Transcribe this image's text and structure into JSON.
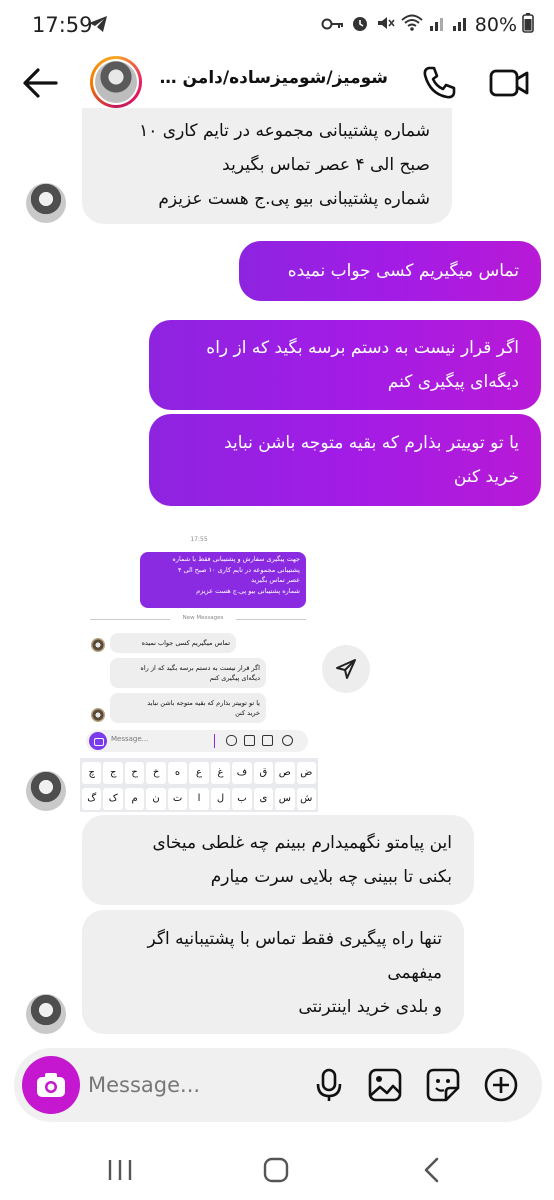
{
  "status_bar": {
    "time": "17:59",
    "battery": "80%",
    "icons": [
      "telegram-icon",
      "key-icon",
      "alarm-icon",
      "mute-icon",
      "wifi-icon",
      "signal-icon",
      "signal-icon",
      "battery-icon"
    ]
  },
  "header": {
    "title": "شومیز/شومیزساده/دامن شل...",
    "icons": [
      "back-arrow-icon",
      "phone-icon",
      "video-icon"
    ]
  },
  "messages": {
    "m1": {
      "lines": [
        "شماره پشتیبانی مجموعه در تایم کاری ۱۰",
        "صبح الی ۴ عصر تماس بگیرید",
        "شماره پشتیبانی بیو پی.ج هست عزیزم"
      ]
    },
    "m2": {
      "lines": [
        "تماس میگیریم کسی جواب نمیده"
      ]
    },
    "m3": {
      "lines": [
        "اگر قرار نیست به دستم برسه بگید که از راه",
        "دیگه‌ای پیگیری کنم"
      ]
    },
    "m4": {
      "lines": [
        "یا تو توییتر بذارم که بقیه متوجه باشن نباید",
        "خرید کنن"
      ]
    },
    "m5": {
      "lines": [
        "این پیامتو نگهمیدارم ببینم چه غلطی میخای",
        "بکنی تا ببینی چه بلایی سرت میارم"
      ]
    },
    "m6": {
      "lines": [
        "تنها راه پیگیری فقط تماس با پشتیبانیه اگر",
        "میفهمی",
        "و بلدی خرید اینترنتی"
      ]
    }
  },
  "shared_screenshot": {
    "time": "17:55",
    "outgoing": [
      "جهت پیگیری سفارش و پشتیبانی فقط با شماره",
      "پشتیبانی مجموعه در تایم کاری ۱۰ صبح الی ۴",
      "عصر تماس بگیرید",
      "شماره پشتیبانی بیو پی.ج هست عزیزم"
    ],
    "new_messages": "New Messages",
    "in1": [
      "تماس میگیریم کسی جواب نمیده"
    ],
    "in2": [
      "اگر قرار نیست به دستم برسه بگید که از راه",
      "دیگه‌ای پیگیری کنم"
    ],
    "in3": [
      "یا تو توییتر بذارم که بقیه متوجه باشن نباید",
      "خرید کنن"
    ],
    "composer_placeholder": "Message...",
    "keyboard_row1": [
      "ض",
      "ص",
      "ق",
      "ف",
      "غ",
      "ع",
      "ه",
      "خ",
      "ح",
      "ج",
      "چ"
    ],
    "keyboard_row2": [
      "ش",
      "س",
      "ی",
      "ب",
      "ل",
      "ا",
      "ت",
      "ن",
      "م",
      "ک",
      "گ"
    ]
  },
  "composer": {
    "placeholder": "Message...",
    "icons": [
      "camera-icon",
      "microphone-icon",
      "gallery-icon",
      "sticker-icon",
      "plus-icon"
    ]
  },
  "navbar": {
    "icons": [
      "recent-apps-icon",
      "home-icon",
      "back-icon"
    ]
  },
  "colors": {
    "outgoing_bubble": "#a21ce6",
    "incoming_bubble": "#efefef",
    "camera_button": "#c517cf"
  }
}
